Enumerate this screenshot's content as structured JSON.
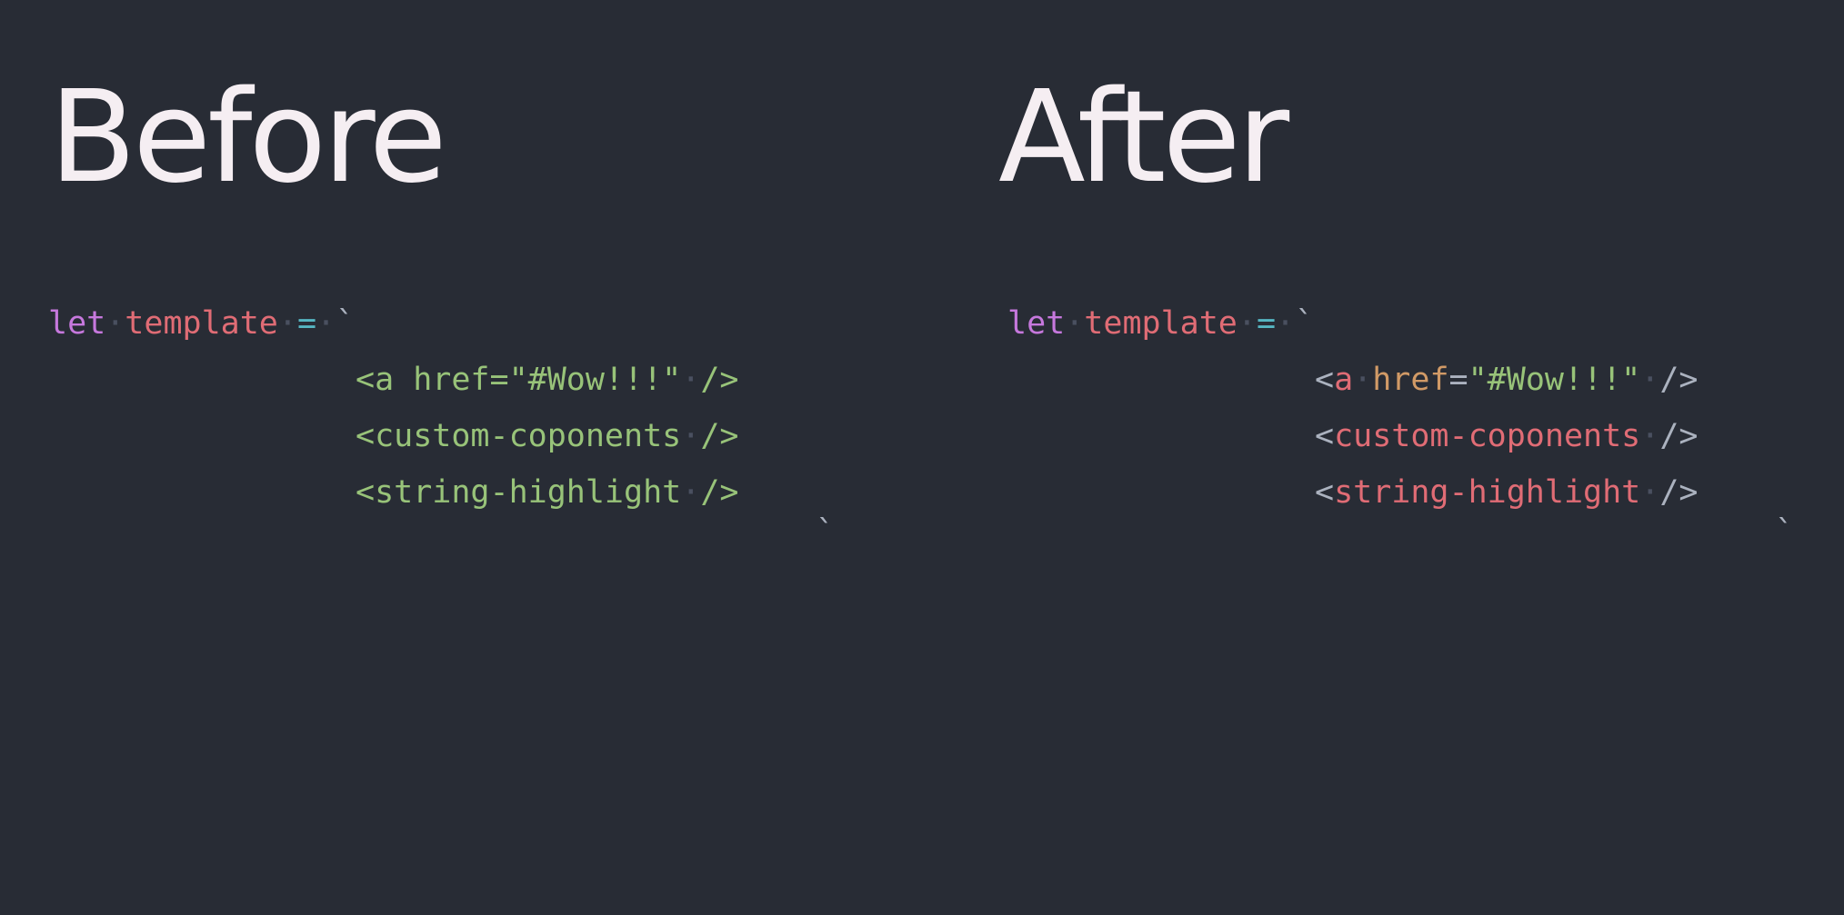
{
  "panels": [
    {
      "heading": "Before",
      "code": {
        "line1": {
          "kw": "let",
          "var": "template",
          "op": "=",
          "tick": "`"
        },
        "line2": {
          "text": "<a href=\"#Wow!!!\"",
          "close": "/>"
        },
        "line3": {
          "text": "<custom-coponents",
          "close": "/>"
        },
        "line4": {
          "text": "<string-highlight",
          "close": "/>"
        },
        "line5": {
          "tick": "`"
        }
      }
    },
    {
      "heading": "After",
      "code": {
        "line1": {
          "kw": "let",
          "var": "template",
          "op": "=",
          "tick": "`"
        },
        "line2": {
          "lt": "<",
          "tag": "a",
          "attr": "href",
          "eq": "=",
          "value": "\"#Wow!!!\"",
          "close": "/>"
        },
        "line3": {
          "lt": "<",
          "tag": "custom-coponents",
          "close": "/>"
        },
        "line4": {
          "lt": "<",
          "tag": "string-highlight",
          "close": "/>"
        },
        "line5": {
          "tick": "`"
        }
      }
    }
  ],
  "colors": {
    "background": "#282c35",
    "heading": "#f5eef2",
    "keyword": "#c678dd",
    "variable": "#e06c75",
    "operator": "#56b6c2",
    "string": "#98c379",
    "attribute": "#d19a66",
    "punctuation": "#abb2bf",
    "whitespace_dot": "#4a5060"
  }
}
